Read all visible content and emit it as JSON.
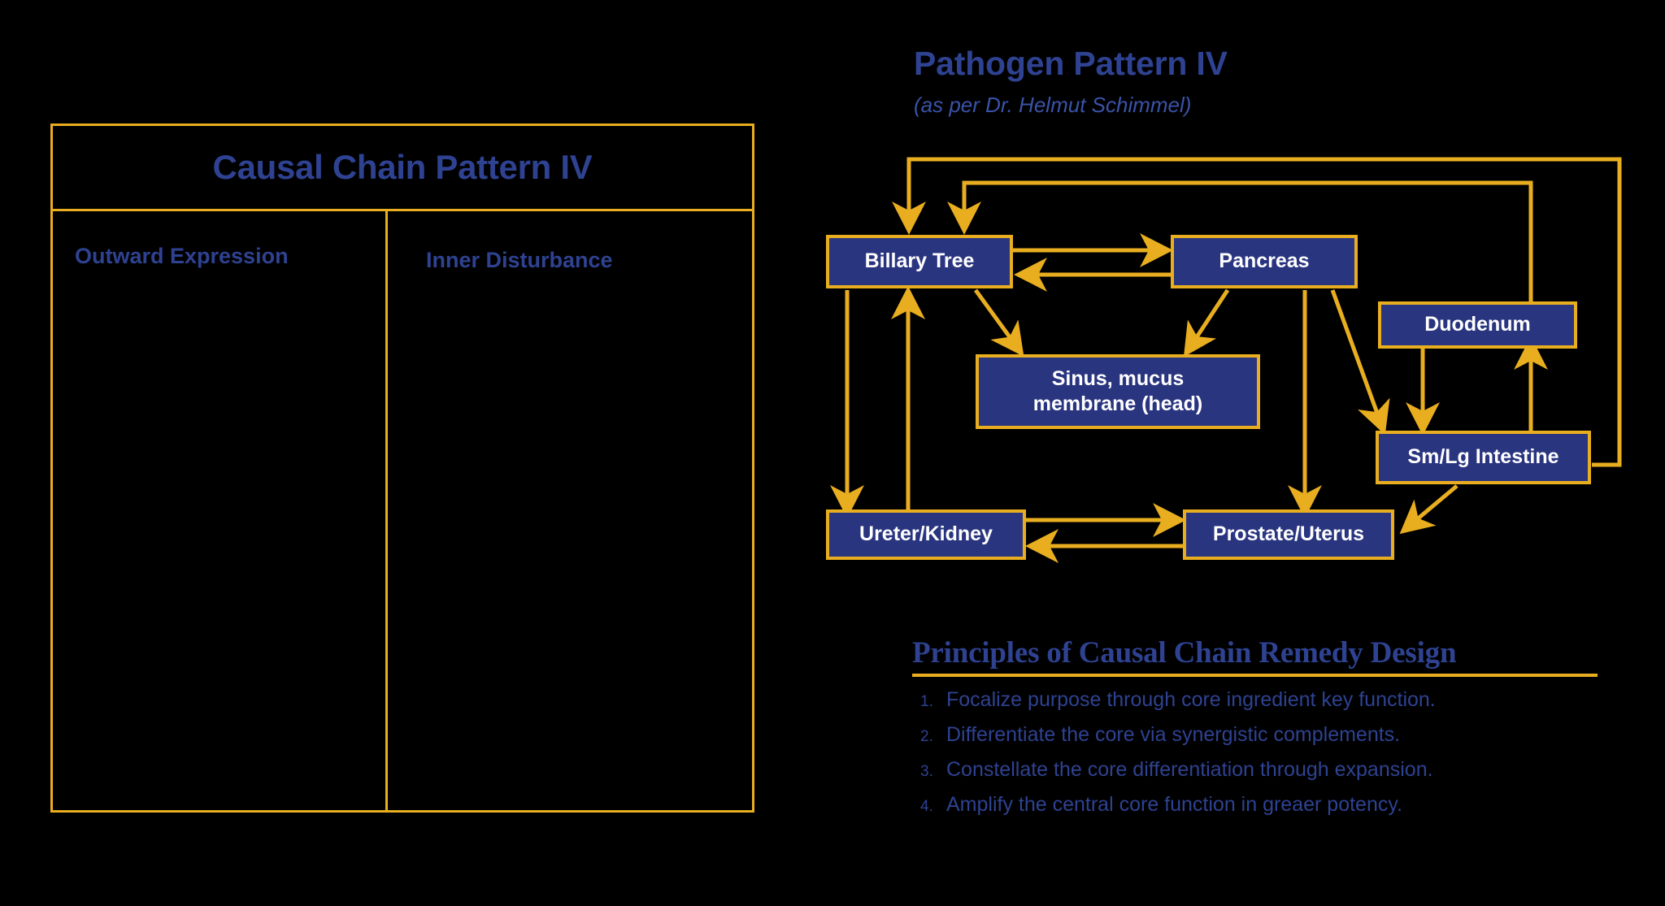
{
  "table": {
    "title": "Causal Chain Pattern IV",
    "columns": [
      {
        "header": "Outward Expression"
      },
      {
        "header": "Inner Disturbance"
      }
    ]
  },
  "pattern": {
    "title": "Pathogen Pattern IV",
    "subtitle": "(as per Dr. Helmut Schimmel)"
  },
  "diagram": {
    "nodes": [
      {
        "id": "biliary",
        "label": "Billary Tree"
      },
      {
        "id": "pancreas",
        "label": "Pancreas"
      },
      {
        "id": "sinus",
        "label": "Sinus, mucus\nmembrane (head)"
      },
      {
        "id": "duodenum",
        "label": "Duodenum"
      },
      {
        "id": "intestine",
        "label": "Sm/Lg Intestine"
      },
      {
        "id": "ureter",
        "label": "Ureter/Kidney"
      },
      {
        "id": "prostate",
        "label": "Prostate/Uterus"
      }
    ]
  },
  "principles": {
    "heading": "Principles of Causal Chain Remedy Design",
    "items": [
      {
        "number": "1.",
        "text": "Focalize purpose through core ingredient key function."
      },
      {
        "number": "2.",
        "text": "Differentiate the core via synergistic complements."
      },
      {
        "number": "3.",
        "text": "Constellate the core differentiation through expansion."
      },
      {
        "number": "4.",
        "text": "Amplify the central core function in greaer potency."
      }
    ]
  },
  "colors": {
    "background": "#000000",
    "gold": "#E8AE1F",
    "node_fill": "#2A3580",
    "heading_blue": "#2E4291",
    "node_text": "#FFFFFF"
  }
}
